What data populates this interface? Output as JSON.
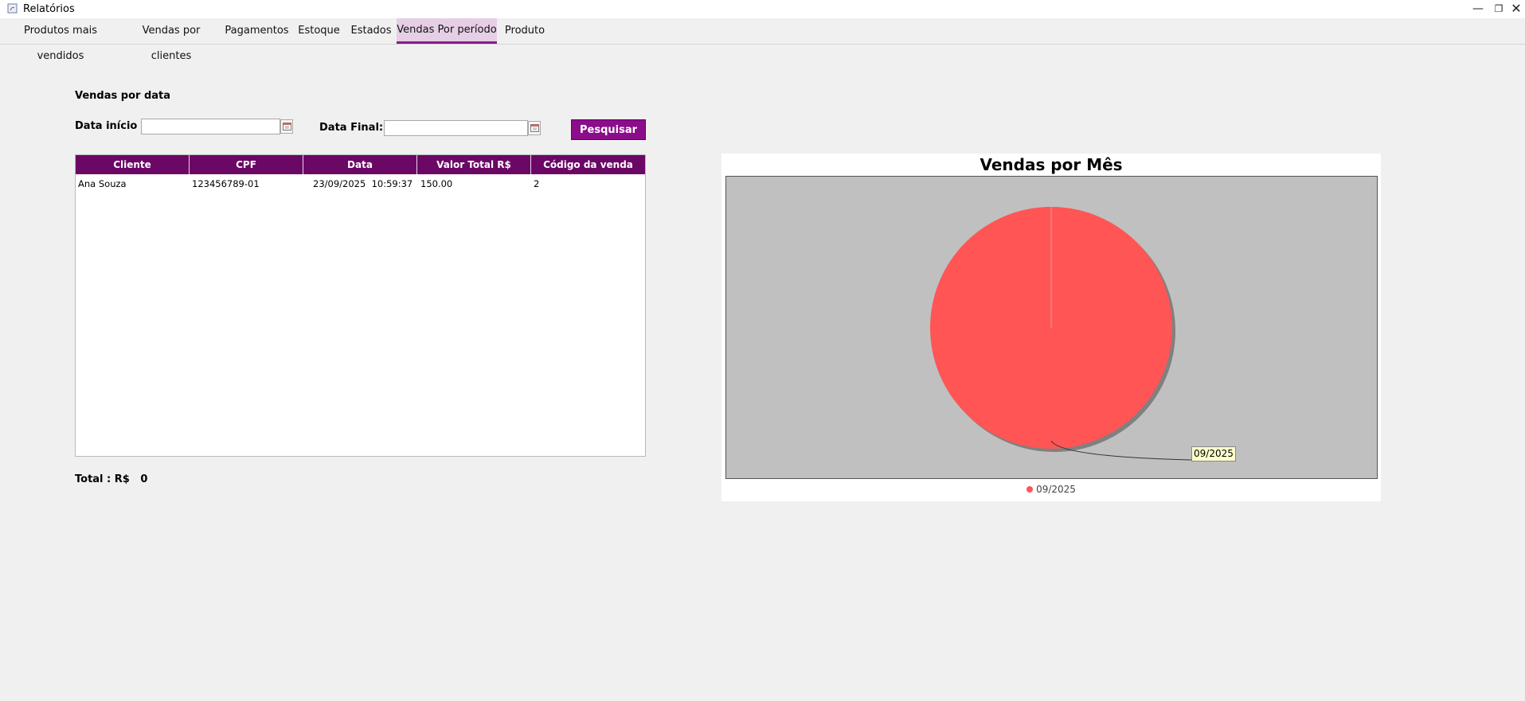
{
  "window": {
    "title": "Relatórios"
  },
  "tabs": [
    {
      "label": "Produtos mais vendidos"
    },
    {
      "label": "Vendas por clientes"
    },
    {
      "label": "Pagamentos"
    },
    {
      "label": "Estoque"
    },
    {
      "label": "Estados"
    },
    {
      "label": "Vendas Por período",
      "active": true
    },
    {
      "label": "Produto"
    }
  ],
  "form": {
    "section_title": "Vendas por data",
    "start_label": "Data início :",
    "start_value": "",
    "end_label": "Data Final:",
    "end_value": "",
    "search_label": "Pesquisar"
  },
  "table": {
    "columns": [
      "Cliente",
      "CPF",
      "Data",
      "Valor Total R$",
      "Código da venda"
    ],
    "rows": [
      [
        "Ana Souza",
        "123456789-01",
        "23/09/2025  10:59:37",
        "150.00",
        "2"
      ]
    ]
  },
  "total": {
    "label": "Total : R$",
    "value": "0"
  },
  "colors": {
    "tab_accent": "#8b1a8b",
    "header_bg": "#6b0765",
    "button_bg": "#8b0d8b",
    "slice": "#ff5555",
    "plot_bg": "#c0c0c0"
  },
  "chart_data": {
    "type": "pie",
    "title": "Vendas por Mês",
    "categories": [
      "09/2025"
    ],
    "values": [
      1
    ],
    "colors": [
      "#ff5555"
    ],
    "legend": [
      "09/2025"
    ],
    "legend_position": "bottom",
    "slice_labels": [
      "09/2025"
    ]
  }
}
